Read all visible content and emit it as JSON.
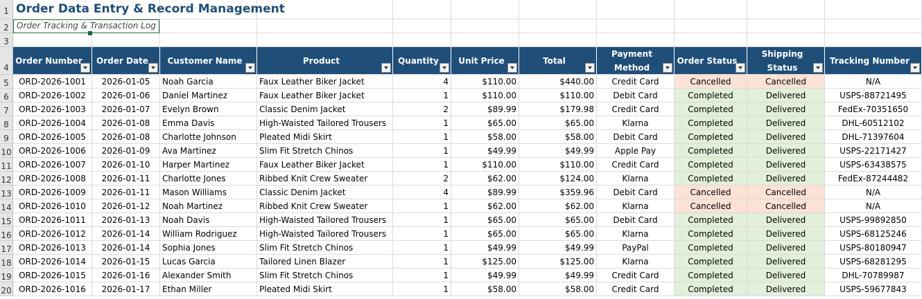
{
  "sheet": {
    "title": "Order Data Entry & Record Management",
    "subtitle": "Order Tracking & Transaction Log",
    "row_numbers": [
      "1",
      "2",
      "3",
      "4",
      "5",
      "6",
      "7",
      "8",
      "9",
      "10",
      "11",
      "12",
      "13",
      "14",
      "15",
      "16",
      "17",
      "18",
      "19",
      "20"
    ],
    "columns": [
      {
        "label": "Order Number"
      },
      {
        "label": "Order Date"
      },
      {
        "label": "Customer Name"
      },
      {
        "label": "Product"
      },
      {
        "label": "Quantity"
      },
      {
        "label": "Unit Price"
      },
      {
        "label": "Total"
      },
      {
        "label": "Payment Method"
      },
      {
        "label": "Order Status"
      },
      {
        "label": "Shipping Status"
      },
      {
        "label": "Tracking Number"
      }
    ],
    "rows": [
      [
        "ORD-2026-1001",
        "2026-01-05",
        "Noah Garcia",
        "Faux Leather Biker Jacket",
        "4",
        "$110.00",
        "$440.00",
        "Credit Card",
        "Cancelled",
        "Cancelled",
        "N/A"
      ],
      [
        "ORD-2026-1002",
        "2026-01-06",
        "Daniel Martinez",
        "Faux Leather Biker Jacket",
        "1",
        "$110.00",
        "$110.00",
        "Debit Card",
        "Completed",
        "Delivered",
        "USPS-88721495"
      ],
      [
        "ORD-2026-1003",
        "2026-01-07",
        "Evelyn Brown",
        "Classic Denim Jacket",
        "2",
        "$89.99",
        "$179.98",
        "Credit Card",
        "Completed",
        "Delivered",
        "FedEx-70351650"
      ],
      [
        "ORD-2026-1004",
        "2026-01-08",
        "Emma Davis",
        "High-Waisted Tailored Trousers",
        "1",
        "$65.00",
        "$65.00",
        "Klarna",
        "Completed",
        "Delivered",
        "DHL-60512102"
      ],
      [
        "ORD-2026-1005",
        "2026-01-08",
        "Charlotte Johnson",
        "Pleated Midi Skirt",
        "1",
        "$58.00",
        "$58.00",
        "Debit Card",
        "Completed",
        "Delivered",
        "DHL-71397604"
      ],
      [
        "ORD-2026-1006",
        "2026-01-09",
        "Ava Martinez",
        "Slim Fit Stretch Chinos",
        "1",
        "$49.99",
        "$49.99",
        "Apple Pay",
        "Completed",
        "Delivered",
        "USPS-22171427"
      ],
      [
        "ORD-2026-1007",
        "2026-01-10",
        "Harper Martinez",
        "Faux Leather Biker Jacket",
        "1",
        "$110.00",
        "$110.00",
        "Credit Card",
        "Completed",
        "Delivered",
        "USPS-63438575"
      ],
      [
        "ORD-2026-1008",
        "2026-01-11",
        "Charlotte Jones",
        "Ribbed Knit Crew Sweater",
        "2",
        "$62.00",
        "$124.00",
        "Klarna",
        "Completed",
        "Delivered",
        "FedEx-87244482"
      ],
      [
        "ORD-2026-1009",
        "2026-01-11",
        "Mason Williams",
        "Classic Denim Jacket",
        "4",
        "$89.99",
        "$359.96",
        "Debit Card",
        "Cancelled",
        "Cancelled",
        "N/A"
      ],
      [
        "ORD-2026-1010",
        "2026-01-12",
        "Noah Martinez",
        "Ribbed Knit Crew Sweater",
        "1",
        "$62.00",
        "$62.00",
        "Klarna",
        "Cancelled",
        "Cancelled",
        "N/A"
      ],
      [
        "ORD-2026-1011",
        "2026-01-13",
        "Noah Davis",
        "High-Waisted Tailored Trousers",
        "1",
        "$65.00",
        "$65.00",
        "Debit Card",
        "Completed",
        "Delivered",
        "USPS-99892850"
      ],
      [
        "ORD-2026-1012",
        "2026-01-14",
        "William Rodriguez",
        "High-Waisted Tailored Trousers",
        "1",
        "$65.00",
        "$65.00",
        "Klarna",
        "Completed",
        "Delivered",
        "USPS-68125246"
      ],
      [
        "ORD-2026-1013",
        "2026-01-14",
        "Sophia Jones",
        "Slim Fit Stretch Chinos",
        "1",
        "$49.99",
        "$49.99",
        "PayPal",
        "Completed",
        "Delivered",
        "USPS-80180947"
      ],
      [
        "ORD-2026-1014",
        "2026-01-15",
        "Lucas Garcia",
        "Tailored Linen Blazer",
        "1",
        "$125.00",
        "$125.00",
        "Klarna",
        "Completed",
        "Delivered",
        "USPS-68281295"
      ],
      [
        "ORD-2026-1015",
        "2026-01-16",
        "Alexander Smith",
        "Slim Fit Stretch Chinos",
        "1",
        "$49.99",
        "$49.99",
        "Credit Card",
        "Completed",
        "Delivered",
        "DHL-70789987"
      ],
      [
        "ORD-2026-1016",
        "2026-01-17",
        "Ethan Miller",
        "Pleated Midi Skirt",
        "1",
        "$58.00",
        "$58.00",
        "Credit Card",
        "Completed",
        "Delivered",
        "USPS-59677843"
      ]
    ]
  },
  "colors": {
    "header_bg": "#1f4e79",
    "cancel_bg": "#fbe2d5",
    "complete_bg": "#e2efda"
  }
}
